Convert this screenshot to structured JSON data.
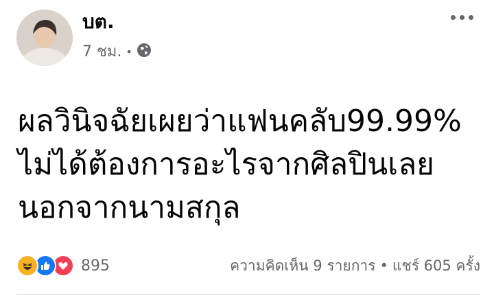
{
  "post": {
    "author": "บต.",
    "time": "7 ชม.",
    "privacy_icon": "globe-icon",
    "content_lines": [
      "ผลวินิจฉัยเผยว่าแฟนคลับ99.99%",
      "ไม่ได้ต้องการอะไรจากศิลปินเลย",
      "นอกจากนามสกุล"
    ]
  },
  "reactions": {
    "icons": [
      "haha-icon",
      "like-icon",
      "love-icon"
    ],
    "count": "895"
  },
  "stats": {
    "comments": "ความคิดเห็น 9 รายการ",
    "separator": "•",
    "shares": "แชร์ 605 ครั้ง"
  },
  "colors": {
    "secondary_text": "#65676b",
    "like": "#1877f2",
    "love": "#f33e58",
    "haha": "#f7b125"
  }
}
